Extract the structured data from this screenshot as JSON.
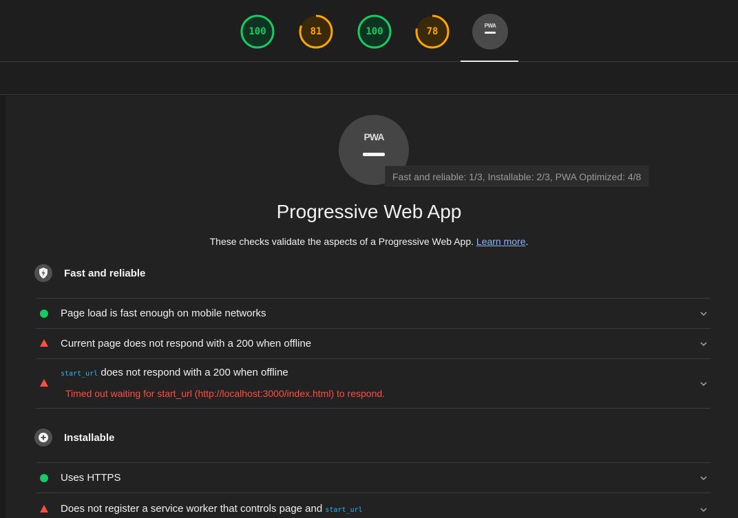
{
  "scores": [
    {
      "value": "100",
      "percent": 100,
      "color": "#18c964",
      "bg": "#0e3320"
    },
    {
      "value": "81",
      "percent": 81,
      "color": "#ffa400",
      "bg": "#3a2a0a"
    },
    {
      "value": "100",
      "percent": 100,
      "color": "#18c964",
      "bg": "#0e3320"
    },
    {
      "value": "78",
      "percent": 78,
      "color": "#ffa400",
      "bg": "#3a2a0a"
    }
  ],
  "pwa_badge": {
    "label": "PWA"
  },
  "tooltip": "Fast and reliable: 1/3, Installable: 2/3, PWA Optimized: 4/8",
  "title": "Progressive Web App",
  "description": "These checks validate the aspects of a Progressive Web App.",
  "learn_more": "Learn more",
  "desc_end": ".",
  "groups": [
    {
      "title": "Fast and reliable"
    },
    {
      "title": "Installable"
    }
  ],
  "audits": [
    {
      "text": "Page load is fast enough on mobile networks",
      "status": "pass"
    },
    {
      "text": "Current page does not respond with a 200 when offline",
      "status": "fail"
    },
    {
      "code": "start_url",
      "text": " does not respond with a 200 when offline",
      "status": "fail",
      "error": "Timed out waiting for start_url (http://localhost:3000/index.html) to respond."
    },
    {
      "text": "Uses HTTPS",
      "status": "pass"
    },
    {
      "text": "Does not register a service worker that controls page and ",
      "code_after": "start_url",
      "status": "fail"
    }
  ]
}
